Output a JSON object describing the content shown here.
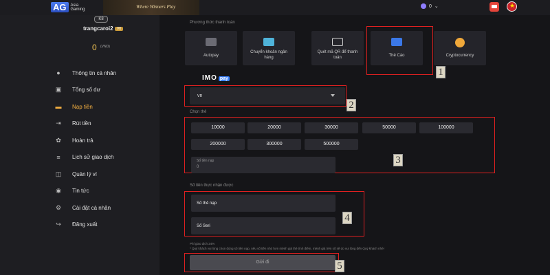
{
  "header": {
    "logo_mark": "AG",
    "logo_sub": "Asia Gaming",
    "banner_text": "Where Winners Play",
    "wallet_value": "0"
  },
  "profile": {
    "badge": "K8",
    "username": "trangcaroi2",
    "vip_badge": "V0",
    "balance": "0",
    "currency": "(VND)"
  },
  "menu": [
    {
      "label": "Thông tin cá nhân",
      "icon": "user-icon",
      "glyph": "●"
    },
    {
      "label": "Tổng số dư",
      "icon": "wallet-icon",
      "glyph": "▣"
    },
    {
      "label": "Nạp tiền",
      "icon": "deposit-icon",
      "glyph": "▬",
      "active": true
    },
    {
      "label": "Rút tiền",
      "icon": "withdraw-icon",
      "glyph": "⇥"
    },
    {
      "label": "Hoàn trả",
      "icon": "refund-icon",
      "glyph": "✿"
    },
    {
      "label": "Lịch sử giao dịch",
      "icon": "history-icon",
      "glyph": "≡"
    },
    {
      "label": "Quản lý ví",
      "icon": "wallet-manage-icon",
      "glyph": "◫"
    },
    {
      "label": "Tin tức",
      "icon": "news-icon",
      "glyph": "◉"
    },
    {
      "label": "Cài đặt cá nhân",
      "icon": "settings-icon",
      "glyph": "⚙"
    },
    {
      "label": "Đăng xuất",
      "icon": "logout-icon",
      "glyph": "↪"
    }
  ],
  "payment": {
    "section_label": "Phương thức thanh toán",
    "methods": [
      {
        "label": "Autopay",
        "icon": "autopay-icon",
        "color": "#6b6b74"
      },
      {
        "label": "Chuyển khoản ngân hàng",
        "icon": "bank-transfer-icon",
        "color": "#4fb3d9"
      },
      {
        "label": "Quét mã QR để thanh toán",
        "icon": "qr-code-icon",
        "color": "#cfcfcf"
      },
      {
        "label": "Thẻ Cào",
        "icon": "scratch-card-icon",
        "color": "#3b78e7"
      },
      {
        "label": "Cryptocurrency",
        "icon": "crypto-icon",
        "color": "#f0a83a"
      }
    ],
    "provider": {
      "name": "IMO",
      "suffix": "pay"
    },
    "select_value": "vn"
  },
  "cards": {
    "section_label": "Chọn thẻ",
    "amounts": [
      "10000",
      "20000",
      "30000",
      "50000",
      "100000",
      "200000",
      "300000",
      "500000"
    ],
    "input_label": "Số tiền nạp",
    "input_value": "0"
  },
  "receive": {
    "section_label": "Số tiền thực nhận được",
    "card_number_placeholder": "Số thẻ nạp",
    "serial_placeholder": "Số Seri",
    "fee_note": "Phí giao dịch 24%",
    "warning_note": "* Quý khách vui lòng chọn đúng số tiền nạp, nếu số tiền nhỏ hơn mệnh giá thẻ tính điểm, mệnh giá trên số sẽ do vui lòng đến Quý khách nhé!",
    "submit_label": "Gửi đi"
  },
  "annotations": [
    "1",
    "2",
    "3",
    "4",
    "5"
  ],
  "colors": {
    "accent": "#f5b041",
    "highlight": "#e02020",
    "background": "#141417"
  }
}
